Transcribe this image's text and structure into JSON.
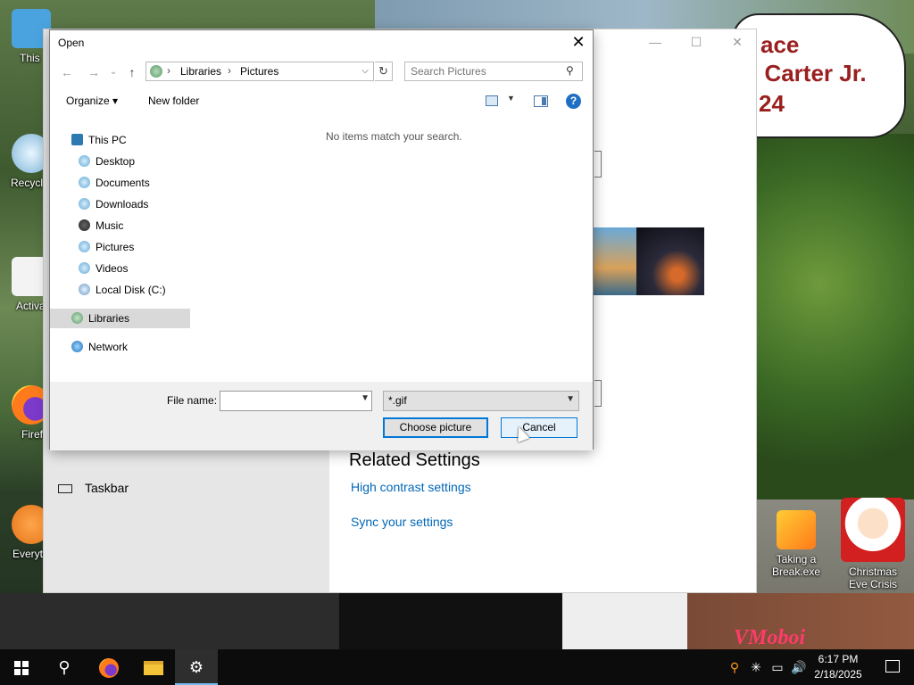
{
  "dialog": {
    "title": "Open",
    "close_glyph": "✕",
    "nav": {
      "back": "←",
      "forward": "→",
      "recent": "⌄",
      "up": "↑",
      "refresh": "↻"
    },
    "address": {
      "crumbs": [
        "Libraries",
        "Pictures"
      ],
      "separator": "›",
      "dropdown": "⌵"
    },
    "search": {
      "placeholder": "Search Pictures",
      "icon": "search-icon"
    },
    "toolbar": {
      "organize": "Organize ▾",
      "new_folder": "New folder",
      "help": "?"
    },
    "nav_tree": [
      {
        "label": "This PC",
        "icon": "computer-icon"
      },
      {
        "label": "Desktop",
        "icon": "desktop-folder-icon"
      },
      {
        "label": "Documents",
        "icon": "documents-folder-icon"
      },
      {
        "label": "Downloads",
        "icon": "downloads-folder-icon"
      },
      {
        "label": "Music",
        "icon": "music-folder-icon"
      },
      {
        "label": "Pictures",
        "icon": "pictures-folder-icon"
      },
      {
        "label": "Videos",
        "icon": "videos-folder-icon"
      },
      {
        "label": "Local Disk (C:)",
        "icon": "disk-icon"
      },
      {
        "label": "Libraries",
        "icon": "libraries-icon",
        "selected": true
      },
      {
        "label": "Network",
        "icon": "network-icon"
      }
    ],
    "empty_message": "No items match your search.",
    "file_name_label": "File name:",
    "file_name_value": "",
    "file_type": "*.gif",
    "buttons": {
      "primary": "Choose picture",
      "cancel": "Cancel"
    }
  },
  "settings_window": {
    "controls": {
      "minimize": "—",
      "maximize": "☐",
      "close": "✕"
    },
    "related_title": "Related Settings",
    "links": [
      "High contrast settings",
      "Sync your settings"
    ],
    "taskbar_item": "Taskbar"
  },
  "desktop": {
    "banner_lines": [
      "ace",
      "l Carter Jr.",
      "24"
    ],
    "icons": [
      {
        "label": "This",
        "icon": "this-pc-icon"
      },
      {
        "label": "Recycl",
        "icon": "recycle-bin-icon"
      },
      {
        "label": "Activa",
        "icon": "activate-icon"
      },
      {
        "label": "Firef",
        "icon": "firefox-icon"
      },
      {
        "label": "Everyt",
        "icon": "everything-search-icon"
      },
      {
        "label": "Taking a Break.exe",
        "icon": "puzzle-exe-icon"
      },
      {
        "label": "Christmas Eve Crisis",
        "icon": "santa-icon"
      }
    ],
    "watermark": "VMoboi"
  },
  "taskbar": {
    "clock": {
      "time": "6:17 PM",
      "date": "2/18/2025"
    },
    "tray_icons": [
      "search-tray-icon",
      "network-activity-icon",
      "network-icon",
      "volume-icon"
    ],
    "volume_glyph": "🔊",
    "apps": [
      "start-icon",
      "search-icon",
      "firefox-icon",
      "file-explorer-icon",
      "settings-icon"
    ],
    "search_glyph": "⚲",
    "settings_glyph": "⚙"
  },
  "colors": {
    "accent": "#0078d7",
    "link": "#0067b8",
    "taskbar": "#0c0c0c",
    "banner_text": "#9a1f1f"
  }
}
